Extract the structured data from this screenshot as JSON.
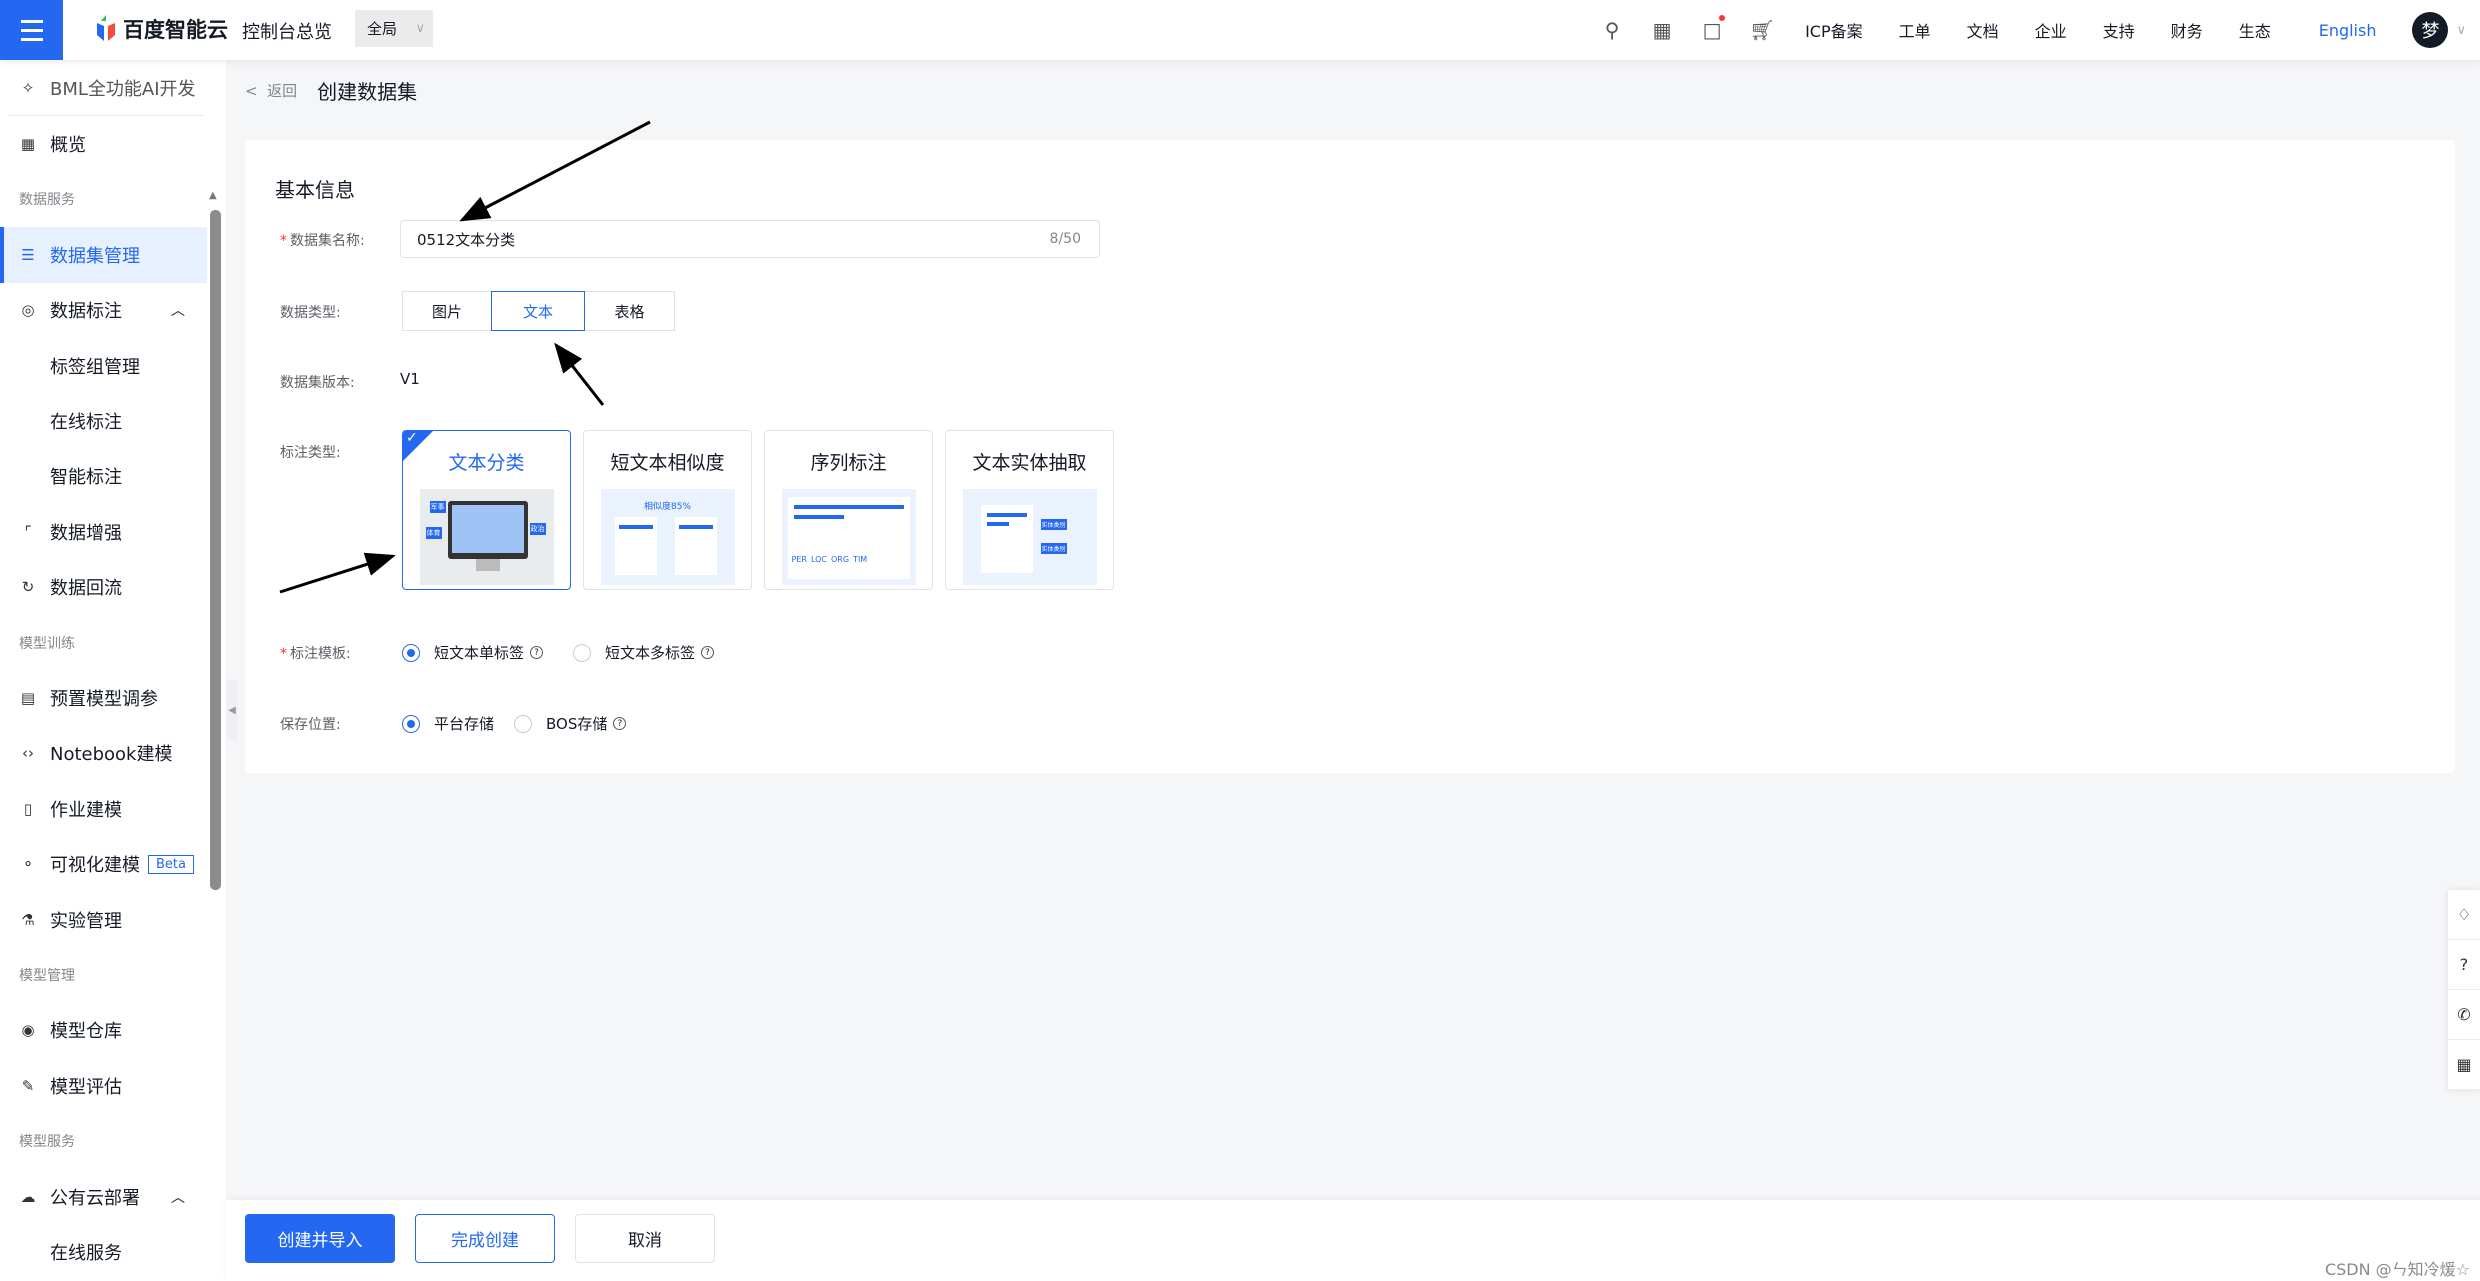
{
  "header": {
    "logo_text": "百度智能云",
    "console_link": "控制台总览",
    "scope": "全局",
    "nav": [
      "ICP备案",
      "工单",
      "文档",
      "企业",
      "支持",
      "财务",
      "生态"
    ],
    "language": "English",
    "avatar_char": "梦",
    "accent": "#2468f2"
  },
  "sidebar": {
    "top_item": "BML全功能AI开发",
    "items": [
      {
        "type": "item",
        "label": "概览",
        "icon": "grid-icon"
      },
      {
        "type": "section",
        "label": "数据服务"
      },
      {
        "type": "item",
        "label": "数据集管理",
        "icon": "database-icon",
        "active": true
      },
      {
        "type": "item",
        "label": "数据标注",
        "icon": "scan-icon",
        "caret": "^"
      },
      {
        "type": "sub",
        "label": "标签组管理"
      },
      {
        "type": "sub",
        "label": "在线标注"
      },
      {
        "type": "sub",
        "label": "智能标注"
      },
      {
        "type": "item",
        "label": "数据增强",
        "icon": "enhance-icon"
      },
      {
        "type": "item",
        "label": "数据回流",
        "icon": "refresh-icon"
      },
      {
        "type": "section",
        "label": "模型训练"
      },
      {
        "type": "item",
        "label": "预置模型调参",
        "icon": "preset-icon"
      },
      {
        "type": "item",
        "label": "Notebook建模",
        "icon": "code-icon"
      },
      {
        "type": "item",
        "label": "作业建模",
        "icon": "job-icon"
      },
      {
        "type": "item",
        "label": "可视化建模",
        "icon": "flow-icon",
        "badge": "Beta"
      },
      {
        "type": "item",
        "label": "实验管理",
        "icon": "flask-icon"
      },
      {
        "type": "section",
        "label": "模型管理"
      },
      {
        "type": "item",
        "label": "模型仓库",
        "icon": "repo-icon"
      },
      {
        "type": "item",
        "label": "模型评估",
        "icon": "evaluate-icon"
      },
      {
        "type": "section",
        "label": "模型服务"
      },
      {
        "type": "item",
        "label": "公有云部署",
        "icon": "cloud-icon",
        "caret": "^"
      },
      {
        "type": "sub",
        "label": "在线服务"
      }
    ]
  },
  "breadcrumb": {
    "back": "返回",
    "title": "创建数据集"
  },
  "form": {
    "section_title": "基本信息",
    "name": {
      "label": "数据集名称:",
      "value": "0512文本分类",
      "count": "8/50"
    },
    "data_type": {
      "label": "数据类型:",
      "options": [
        "图片",
        "文本",
        "表格"
      ],
      "selected": "文本"
    },
    "version": {
      "label": "数据集版本:",
      "value": "V1"
    },
    "annotation_type": {
      "label": "标注类型:",
      "selected": "文本分类",
      "cards": [
        {
          "title": "文本分类",
          "tags": [
            "军事",
            "体育",
            "政治"
          ]
        },
        {
          "title": "短文本相似度",
          "caption": "相似度85%"
        },
        {
          "title": "序列标注",
          "tags": [
            "PER",
            "LOC",
            "ORG",
            "TIM"
          ]
        },
        {
          "title": "文本实体抽取",
          "tags": [
            "实体类别",
            "实体类别"
          ]
        }
      ]
    },
    "template": {
      "label": "标注模板:",
      "options": [
        "短文本单标签",
        "短文本多标签"
      ],
      "selected": "短文本单标签"
    },
    "storage": {
      "label": "保存位置:",
      "options": [
        "平台存储",
        "BOS存储"
      ],
      "selected": "平台存储"
    }
  },
  "footer": {
    "create_import": "创建并导入",
    "finish": "完成创建",
    "cancel": "取消"
  },
  "watermark": "CSDN @ㄣ知冷煖☆"
}
